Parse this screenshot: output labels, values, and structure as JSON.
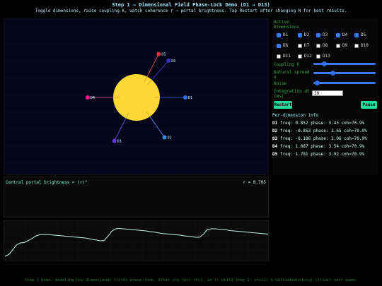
{
  "header": {
    "title": "Step 1 — Dimensional Field Phase-Lock Demo (D1 → D13)",
    "subtitle": "Toggle dimensions, raise coupling K, watch coherence r → portal brightness. Tap Restart after changing N for best results."
  },
  "visual": {
    "core_color": "#fdd835",
    "nodes": [
      {
        "id": "D1",
        "label": "D1",
        "angle": 0,
        "color": "#2f6ee6",
        "line": "#3b6ef0"
      },
      {
        "id": "D2",
        "label": "D2",
        "angle": 55,
        "color": "#2f8ee6",
        "line": "#4f8ef0"
      },
      {
        "id": "D3",
        "label": "D3",
        "angle": 117,
        "color": "#6a33e8",
        "line": "#6a5cf0"
      },
      {
        "id": "D4",
        "label": "D4",
        "angle": 180,
        "color": "#e8179a",
        "line": "#e86ab0"
      },
      {
        "id": "D5",
        "label": "D5",
        "angle": 297,
        "color": "#e8333a",
        "line": "#e8604a"
      },
      {
        "id": "D6",
        "label": "D6",
        "angle": 311,
        "color": "#2f33c8",
        "line": "#3a44d8"
      }
    ]
  },
  "brightness": {
    "label": "Central portal brightness = ⟨r⟩²",
    "value": "r = 0.705"
  },
  "panel": {
    "active_label": "Active Dimensions",
    "dims": [
      {
        "label": "D1",
        "on": true
      },
      {
        "label": "D2",
        "on": true
      },
      {
        "label": "D3",
        "on": true
      },
      {
        "label": "D4",
        "on": true
      },
      {
        "label": "D5",
        "on": true
      },
      {
        "label": "D6",
        "on": true
      },
      {
        "label": "D7",
        "on": false
      },
      {
        "label": "D8",
        "on": false
      },
      {
        "label": "D9",
        "on": false
      },
      {
        "label": "D10",
        "on": false
      },
      {
        "label": "D11",
        "on": false
      },
      {
        "label": "D12",
        "on": false
      },
      {
        "label": "D13",
        "on": false
      }
    ],
    "coupling_label": "Coupling K",
    "coupling_value": 0.3,
    "spread_label": "Natural spread σ",
    "spread_value": 0.15,
    "noise_label": "Noise",
    "noise_value": 0.02,
    "dt_label": "Integration dt (ms)",
    "dt_value": "30",
    "restart_label": "Restart",
    "pause_label": "Pause"
  },
  "info": {
    "heading": "Per-dimension info",
    "rows": [
      {
        "id": "D1",
        "text": "freq: 0.852   phase: 3.43   coh=70.9%"
      },
      {
        "id": "D2",
        "text": "freq: -0.853   phase: 2.65   coh=70.9%"
      },
      {
        "id": "D3",
        "text": "freq: -0.186   phase: 2.96   coh=70.9%"
      },
      {
        "id": "D4",
        "text": "freq: 1.087   phase: 3.54   coh=70.9%"
      },
      {
        "id": "D5",
        "text": "freq: 1.781   phase: 3.92   coh=70.9%"
      }
    ]
  },
  "plot": {
    "line_color": "#bff5ee",
    "values": [
      0.08,
      0.13,
      0.26,
      0.4,
      0.46,
      0.47,
      0.52,
      0.58,
      0.65,
      0.69,
      0.7,
      0.7,
      0.69,
      0.68,
      0.67,
      0.66,
      0.65,
      0.64,
      0.63,
      0.62,
      0.61,
      0.6,
      0.58,
      0.56,
      0.54,
      0.52,
      0.53,
      0.65,
      0.79,
      0.86,
      0.87,
      0.86,
      0.85,
      0.84,
      0.83,
      0.82,
      0.81,
      0.8,
      0.78,
      0.77,
      0.75,
      0.73,
      0.72,
      0.71,
      0.7,
      0.69,
      0.68,
      0.66,
      0.65,
      0.64,
      0.62,
      0.62,
      0.7,
      0.83,
      0.86,
      0.86,
      0.85,
      0.84,
      0.83,
      0.81,
      0.8,
      0.79,
      0.78,
      0.77,
      0.76,
      0.75,
      0.74,
      0.73,
      0.72,
      0.71
    ]
  },
  "footer": "Step 1 demo: modeling how dimensional fields phase-lock. After you test this, we'll build Step 2: crisis & multidimensional circuit test game."
}
